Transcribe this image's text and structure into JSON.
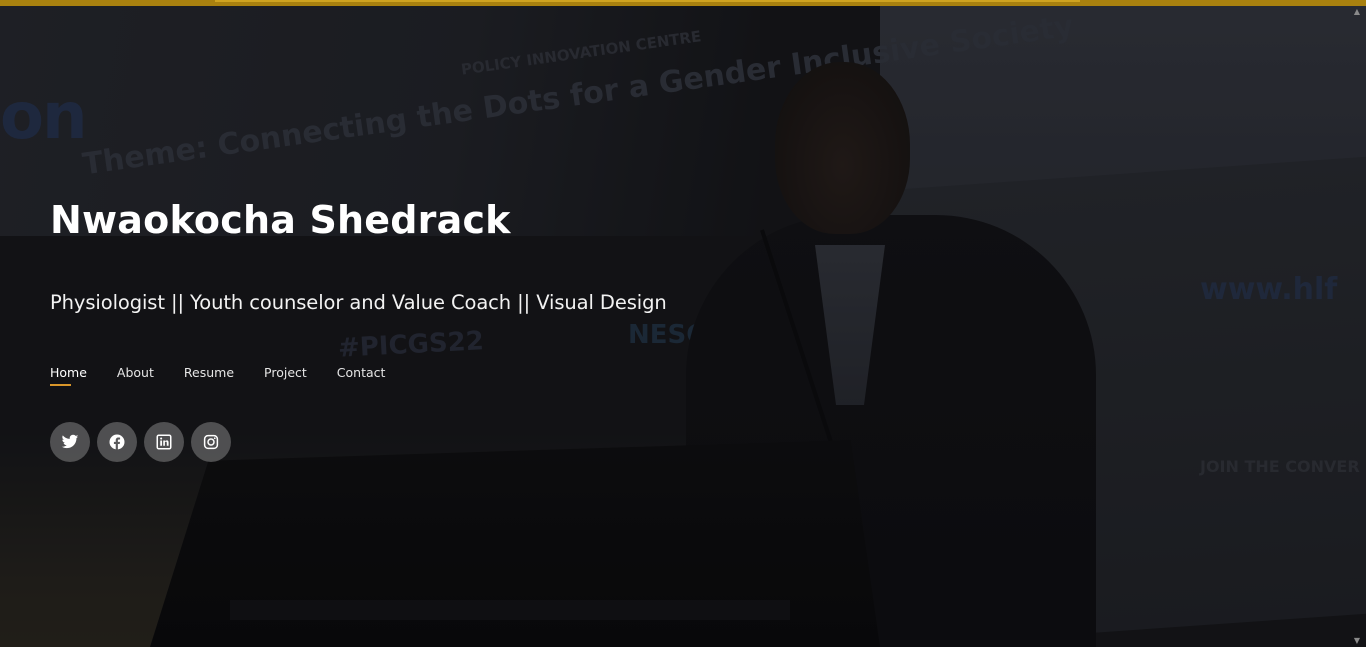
{
  "hero": {
    "name": "Nwaokocha Shedrack",
    "tagline": "Physiologist || Youth counselor and Value Coach || Visual Design"
  },
  "background_text": {
    "theme": "Theme: Connecting the Dots for a Gender Inclusive Society",
    "org": "POLICY INNOVATION CENTRE",
    "website": "www.hlf",
    "hashtag_right": "JOIN THE CONVER #PICGS",
    "hashtag_center": "#PICGS22",
    "nesg": "NESG",
    "left_fragment": "on"
  },
  "nav": {
    "items": [
      {
        "label": "Home",
        "active": true
      },
      {
        "label": "About",
        "active": false
      },
      {
        "label": "Resume",
        "active": false
      },
      {
        "label": "Project",
        "active": false
      },
      {
        "label": "Contact",
        "active": false
      }
    ]
  },
  "socials": [
    {
      "name": "twitter-icon"
    },
    {
      "name": "facebook-icon"
    },
    {
      "name": "linkedin-icon"
    },
    {
      "name": "instagram-icon"
    }
  ],
  "colors": {
    "accent": "#d9962a",
    "top_bar": "#a9810f",
    "text": "#ffffff",
    "social_bg": "#5a5a5c"
  },
  "scrollbar": {
    "up": "▲",
    "down": "▼"
  }
}
